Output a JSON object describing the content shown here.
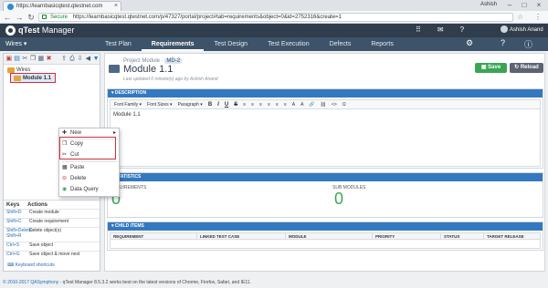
{
  "browser": {
    "tab_title": "https://learnbasicqtest.qtestnet.com",
    "secure_label": "Secure",
    "url": "https://learnbasicqtest.qtestnet.com/p/47327/portal/project#tab=requirements&object=0&id=2752316&create=1",
    "user": "Ashish",
    "icons": [
      "back-icon",
      "forward-icon",
      "reload-icon",
      "lock-icon",
      "star-icon",
      "menu-icon"
    ]
  },
  "header": {
    "logo_q": "qTest",
    "logo_rest": " Manager",
    "user_name": "Ashish Anand"
  },
  "nav": {
    "project": "Wires ▾",
    "tabs": [
      {
        "label": "Test Plan",
        "active": false
      },
      {
        "label": "Requirements",
        "active": true
      },
      {
        "label": "Test Design",
        "active": false
      },
      {
        "label": "Test Execution",
        "active": false
      },
      {
        "label": "Defects",
        "active": false
      },
      {
        "label": "Reports",
        "active": false
      }
    ]
  },
  "tree": {
    "root": "Wires",
    "child": "Module 1.1"
  },
  "context_menu": {
    "items": [
      "New",
      "Copy",
      "Cut",
      "Paste",
      "Delete",
      "Data Query"
    ]
  },
  "shortcuts": {
    "header_keys": "Keys",
    "header_actions": "Actions",
    "rows": [
      {
        "key": "Shift+D",
        "action": "Create module"
      },
      {
        "key": "Shift+C",
        "action": "Create requirement"
      },
      {
        "key": "Shift+Delete,\nShift+R",
        "action": "Delete object(s)"
      },
      {
        "key": "Ctrl+S",
        "action": "Save object"
      },
      {
        "key": "Ctrl+G",
        "action": "Save object & move next"
      }
    ],
    "link": "Keyboard shortcuts"
  },
  "main": {
    "project_module_label": "Project Module",
    "module_id": "MD-2",
    "title": "Module 1.1",
    "last_updated": "Last updated 0 minute(s) ago by Ashish Anand",
    "save_label": "Save",
    "reload_label": "Reload",
    "description_header": "DESCRIPTION",
    "editor": {
      "font_family": "Font Family",
      "font_sizes": "Font Sizes",
      "paragraph": "Paragraph",
      "buttons": [
        "B",
        "I",
        "U",
        "S",
        "≡",
        "≡",
        "≡",
        "≡",
        "≡",
        "≡",
        "A",
        "A",
        "🔗",
        "⛓",
        "<>",
        "Ω"
      ]
    },
    "description_text": "Module 1.1",
    "statistics_header": "STATISTICS",
    "requirements_label": "REQUIREMENTS",
    "requirements_value": "0",
    "submodules_label": "SUB MODULES",
    "submodules_value": "0",
    "child_items_header": "CHILD ITEMS",
    "child_columns": [
      "REQUIREMENT",
      "LINKED TEST CASE",
      "MODULE",
      "PRIORITY",
      "STATUS",
      "TARGET RELEASE"
    ]
  },
  "footer": {
    "copyright": "© 2010-2017 QASymphony",
    "note": " · qTest Manager 8.5.3.2 works best on the latest versions of Chrome, Firefox, Safari, and IE11."
  },
  "colors": {
    "header_bg": "#2f3d4c",
    "nav_bg": "#3d5369",
    "section_header": "#3479bf",
    "save_green": "#3aa655",
    "highlight_red": "#d32d3a"
  }
}
